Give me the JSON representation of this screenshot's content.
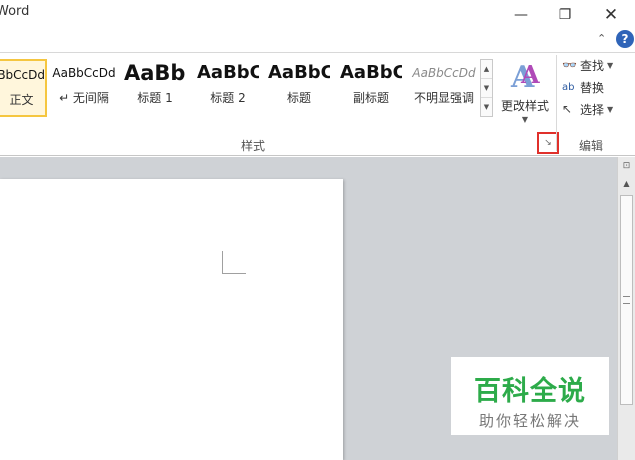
{
  "window": {
    "title": "Word",
    "minimize_glyph": "—",
    "maximize_glyph": "❐",
    "close_glyph": "✕",
    "ribbon_collapse_glyph": "⌃",
    "help_glyph": "?"
  },
  "styles_group": {
    "label": "样式",
    "tiles": [
      {
        "preview": "AaBbCcDd",
        "caption": "正文",
        "selected": true
      },
      {
        "preview": "AaBbCcDd",
        "caption": "↵ 无间隔",
        "selected": false
      },
      {
        "preview": "AaBb",
        "caption": "标题 1",
        "selected": false
      },
      {
        "preview": "AaBbC",
        "caption": "标题 2",
        "selected": false
      },
      {
        "preview": "AaBbC",
        "caption": "标题",
        "selected": false
      },
      {
        "preview": "AaBbC",
        "caption": "副标题",
        "selected": false
      },
      {
        "preview": "AaBbCcDd",
        "caption": "不明显强调",
        "selected": false
      }
    ],
    "change_styles_label": "更改样式",
    "dialog_launcher_glyph": "↘",
    "highlight_color": "#e0302b"
  },
  "editing_group": {
    "label": "编辑",
    "find_label": "查找",
    "replace_label": "替换",
    "select_label": "选择"
  },
  "watermark": {
    "main": "百科全说",
    "sub": "助你轻松解决",
    "color": "#2dab4a"
  }
}
